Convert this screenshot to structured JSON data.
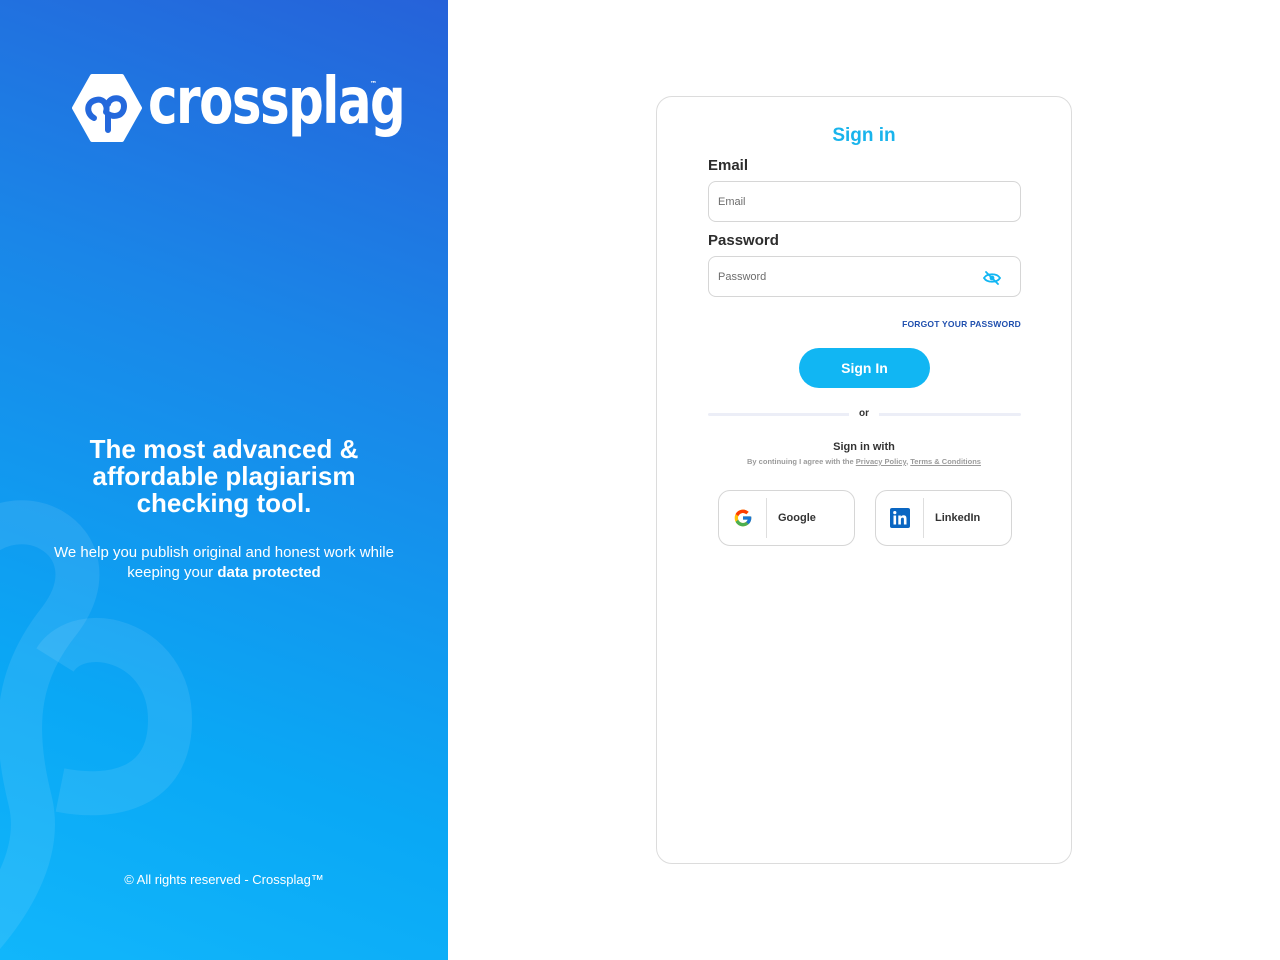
{
  "brand": {
    "name": "crossplag",
    "tm": "™",
    "headline": "The most advanced & affordable plagiarism checking tool.",
    "sub_prefix": "We help you publish original and honest work while keeping your ",
    "sub_bold": "data protected",
    "copyright": "© All rights reserved - Crossplag™"
  },
  "form": {
    "title": "Sign in",
    "email_label": "Email",
    "email_placeholder": "Email",
    "password_label": "Password",
    "password_placeholder": "Password",
    "forgot": "FORGOT YOUR PASSWORD",
    "submit": "Sign In",
    "or": "or",
    "sign_in_with": "Sign in with",
    "agree_prefix": "By continuing I agree with the ",
    "privacy": "Privacy Policy",
    "terms": "Terms & Conditions",
    "google": "Google",
    "linkedin": "LinkedIn"
  },
  "colors": {
    "accent": "#11b6f3",
    "link": "#1f4fae",
    "panel_top": "#2662d9",
    "panel_bottom": "#11b6fb"
  },
  "icons": {
    "password_toggle": "eye-off-icon",
    "google": "google-icon",
    "linkedin": "linkedin-icon"
  }
}
